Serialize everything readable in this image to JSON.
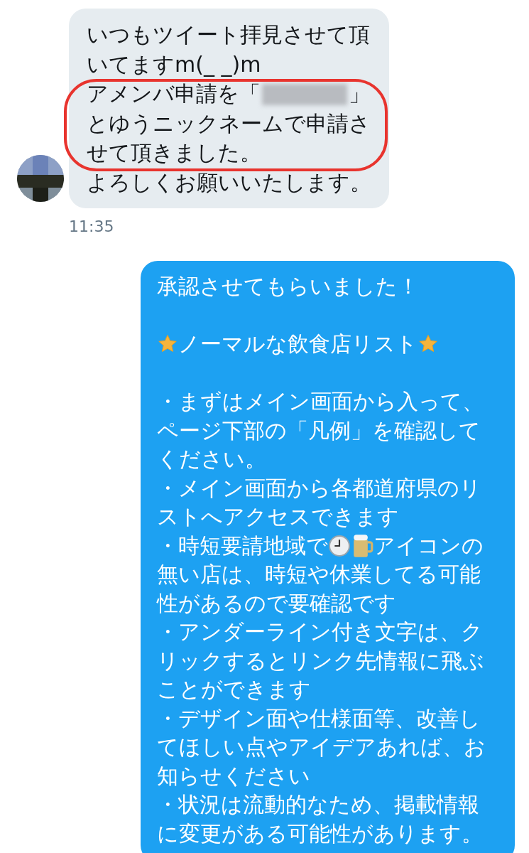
{
  "messages": [
    {
      "kind": "incoming",
      "time": "11:35",
      "lines": [
        {
          "kind": "text",
          "text": "いつもツイート拝見させて頂"
        },
        {
          "kind": "text",
          "text": "いてますm(_ _)m"
        },
        {
          "kind": "mixed",
          "parts": [
            {
              "kind": "text",
              "text": "アメンバ申請を「"
            },
            {
              "kind": "redacted"
            },
            {
              "kind": "text",
              "text": "」"
            }
          ]
        },
        {
          "kind": "text",
          "text": "とゆうニックネームで申請さ"
        },
        {
          "kind": "text",
          "text": "せて頂きました。"
        },
        {
          "kind": "text",
          "text": "よろしくお願いいたします。"
        }
      ]
    },
    {
      "kind": "outgoing",
      "lines": [
        {
          "kind": "text",
          "text": "承認させてもらいました！"
        },
        {
          "kind": "blank"
        },
        {
          "kind": "mixed",
          "parts": [
            {
              "kind": "star"
            },
            {
              "kind": "text",
              "text": "ノーマルな飲食店リスト"
            },
            {
              "kind": "star"
            }
          ]
        },
        {
          "kind": "blank"
        },
        {
          "kind": "text",
          "text": "・まずはメイン画面から入って、"
        },
        {
          "kind": "text",
          "text": "ページ下部の「凡例」を確認して"
        },
        {
          "kind": "text",
          "text": "ください。"
        },
        {
          "kind": "text",
          "text": "・メイン画面から各都道府県のリ"
        },
        {
          "kind": "text",
          "text": "ストへアクセスできます"
        },
        {
          "kind": "mixed",
          "parts": [
            {
              "kind": "text",
              "text": "・時短要請地域で"
            },
            {
              "kind": "clock"
            },
            {
              "kind": "mug"
            },
            {
              "kind": "text",
              "text": "アイコンの"
            }
          ]
        },
        {
          "kind": "text",
          "text": "無い店は、時短や休業してる可能"
        },
        {
          "kind": "text",
          "text": "性があるので要確認です"
        },
        {
          "kind": "text",
          "text": "・アンダーライン付き文字は、ク"
        },
        {
          "kind": "text",
          "text": "リックするとリンク先情報に飛ぶ"
        },
        {
          "kind": "text",
          "text": "ことができます"
        },
        {
          "kind": "text",
          "text": "・デザイン面や仕様面等、改善し"
        },
        {
          "kind": "text",
          "text": "てほしい点やアイデアあれば、お"
        },
        {
          "kind": "text",
          "text": "知らせください"
        },
        {
          "kind": "text",
          "text": "・状況は流動的なため、掲載情報"
        },
        {
          "kind": "text",
          "text": "に変更がある可能性があります。"
        }
      ]
    }
  ]
}
